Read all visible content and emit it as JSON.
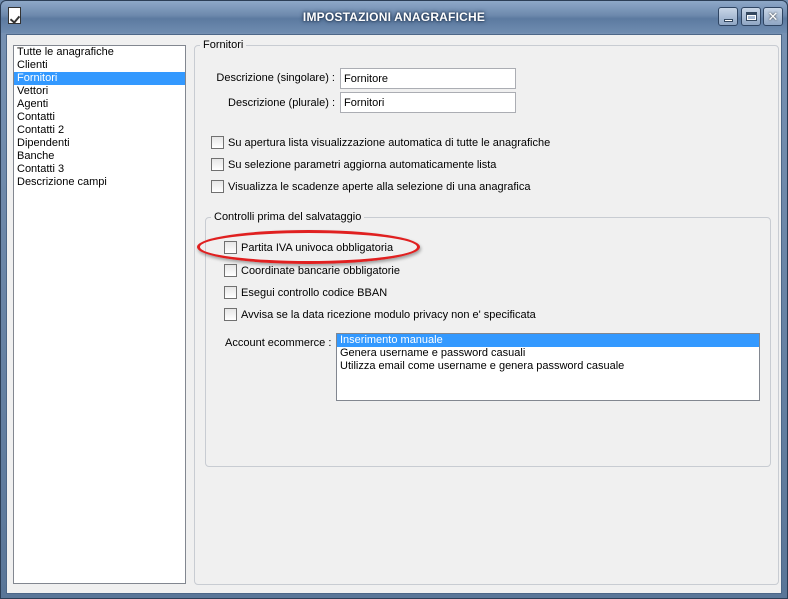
{
  "window": {
    "title": "IMPOSTAZIONI ANAGRAFICHE",
    "icon": "checklist-app-icon",
    "controls": {
      "minimize": "minimize-icon",
      "maximize": "maximize-icon",
      "close": "✕"
    }
  },
  "sidebar": {
    "items": [
      {
        "label": "Tutte le anagrafiche",
        "selected": false
      },
      {
        "label": "Clienti",
        "selected": false
      },
      {
        "label": "Fornitori",
        "selected": true
      },
      {
        "label": "Vettori",
        "selected": false
      },
      {
        "label": "Agenti",
        "selected": false
      },
      {
        "label": "Contatti",
        "selected": false
      },
      {
        "label": "Contatti 2",
        "selected": false
      },
      {
        "label": "Dipendenti",
        "selected": false
      },
      {
        "label": "Banche",
        "selected": false
      },
      {
        "label": "Contatti 3",
        "selected": false
      },
      {
        "label": "Descrizione campi",
        "selected": false
      }
    ]
  },
  "main": {
    "group_title": "Fornitori",
    "desc_singular_label": "Descrizione (singolare) :",
    "desc_singular_value": "Fornitore",
    "desc_plural_label": "Descrizione (plurale) :",
    "desc_plural_value": "Fornitori",
    "options": [
      {
        "label": "Su apertura lista visualizzazione automatica di tutte le anagrafiche",
        "checked": false
      },
      {
        "label": "Su selezione parametri aggiorna automaticamente lista",
        "checked": false
      },
      {
        "label": "Visualizza le scadenze aperte alla selezione di una anagrafica",
        "checked": false
      }
    ],
    "controls_group": {
      "title": "Controlli prima del salvataggio",
      "checks": [
        {
          "label": "Partita IVA univoca obbligatoria",
          "checked": false
        },
        {
          "label": "Coordinate bancarie obbligatorie",
          "checked": false
        },
        {
          "label": "Esegui controllo codice BBAN",
          "checked": false
        },
        {
          "label": "Avvisa se la data ricezione modulo privacy non e' specificata",
          "checked": false
        }
      ],
      "ecommerce_label": "Account ecommerce :",
      "ecommerce_options": [
        {
          "label": "Inserimento manuale",
          "selected": true
        },
        {
          "label": "Genera username e password casuali",
          "selected": false
        },
        {
          "label": "Utilizza email come username e genera password casuale",
          "selected": false
        }
      ]
    }
  },
  "colors": {
    "selection": "#3399ff",
    "annotation": "#e02020",
    "title_bar": "#6d89ad"
  }
}
